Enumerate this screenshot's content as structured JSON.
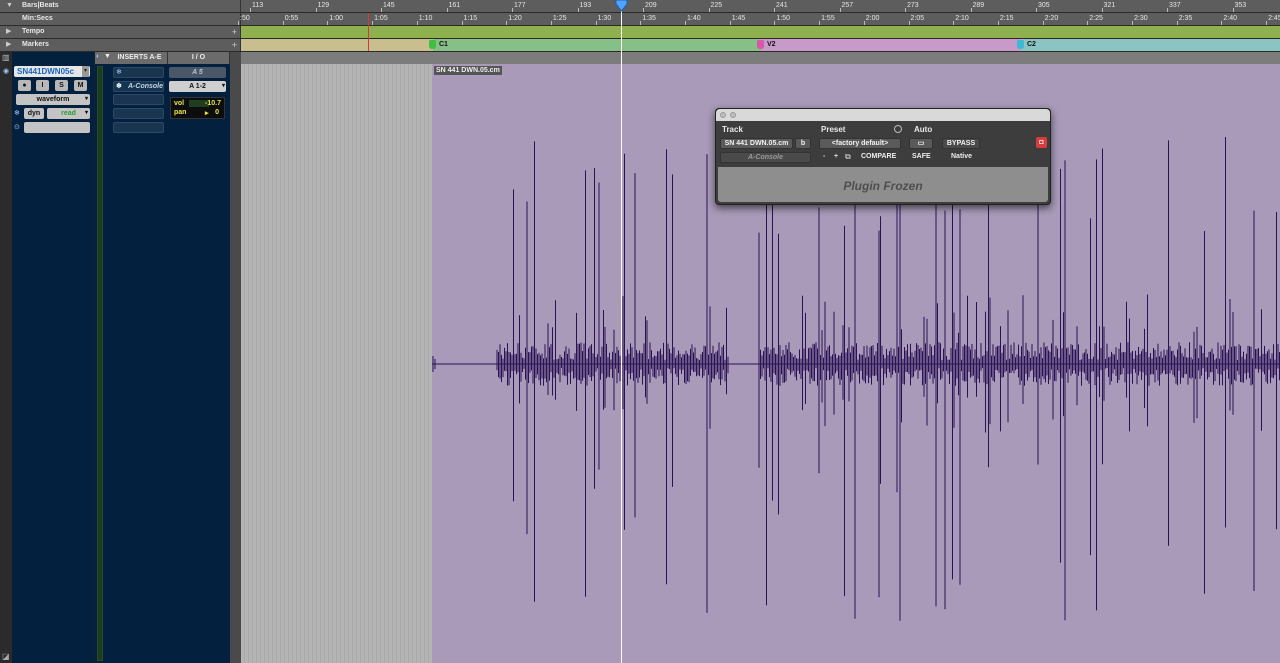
{
  "rulers": {
    "bars_beats_label": "Bars|Beats",
    "min_secs_label": "Min:Secs",
    "tempo_label": "Tempo",
    "markers_label": "Markers",
    "bars_ticks": [
      "113",
      "129",
      "145",
      "161",
      "177",
      "193",
      "209",
      "225",
      "241",
      "257",
      "273",
      "289",
      "305",
      "321",
      "337",
      "353"
    ],
    "min_secs_ticks": [
      ":50",
      "0:55",
      "1:00",
      "1:05",
      "1:10",
      "1:15",
      "1:20",
      "1:25",
      "1:30",
      "1:35",
      "1:40",
      "1:45",
      "1:50",
      "1:55",
      "2:00",
      "2:05",
      "2:10",
      "2:15",
      "2:20",
      "2:25",
      "2:30",
      "2:35",
      "2:40",
      "2:45"
    ],
    "markers": [
      {
        "label": "C1",
        "color": "#3fbf3f"
      },
      {
        "label": "V2",
        "color": "#d957a6"
      },
      {
        "label": "C2",
        "color": "#3fb7d6"
      }
    ],
    "colors": {
      "tempo_lane": "#8fb04e",
      "marker_green": "#86c087",
      "marker_pink": "#c79ac9",
      "marker_cyan": "#8cc3c3",
      "marker_pre": "#c8be8e"
    }
  },
  "track": {
    "name": "SN441DWN05c",
    "buttons": {
      "record": "●",
      "input": "I",
      "solo": "S",
      "mute": "M"
    },
    "view": "waveform",
    "automation": {
      "dyn": "dyn",
      "mode": "read"
    }
  },
  "inserts": {
    "header": "INSERTS A-E",
    "slots": [
      "A-Console",
      "",
      "",
      ""
    ]
  },
  "io": {
    "header": "I / O",
    "input": "A 5",
    "output": "A 1-2",
    "vol_label": "vol",
    "vol_value": "-10.7",
    "pan_label": "pan",
    "pan_arrow": "▸",
    "pan_value": "0"
  },
  "region": {
    "title": "SN 441 DWN.05.cm",
    "color": "#a89ab8",
    "wave_color": "#2a1355"
  },
  "plugin": {
    "track_label": "Track",
    "preset_label": "Preset",
    "auto_label": "Auto",
    "track_name": "SN 441 DWN.05.cm",
    "track_suffix": "b",
    "insert_name": "A-Console",
    "preset_name": "<factory default>",
    "minus": "-",
    "plus": "+",
    "compare": "COMPARE",
    "bypass": "BYPASS",
    "safe": "SAFE",
    "native": "Native",
    "status": "Plugin Frozen"
  },
  "playhead_color": "#ffffff",
  "cursor_color": "#4fa3ff"
}
